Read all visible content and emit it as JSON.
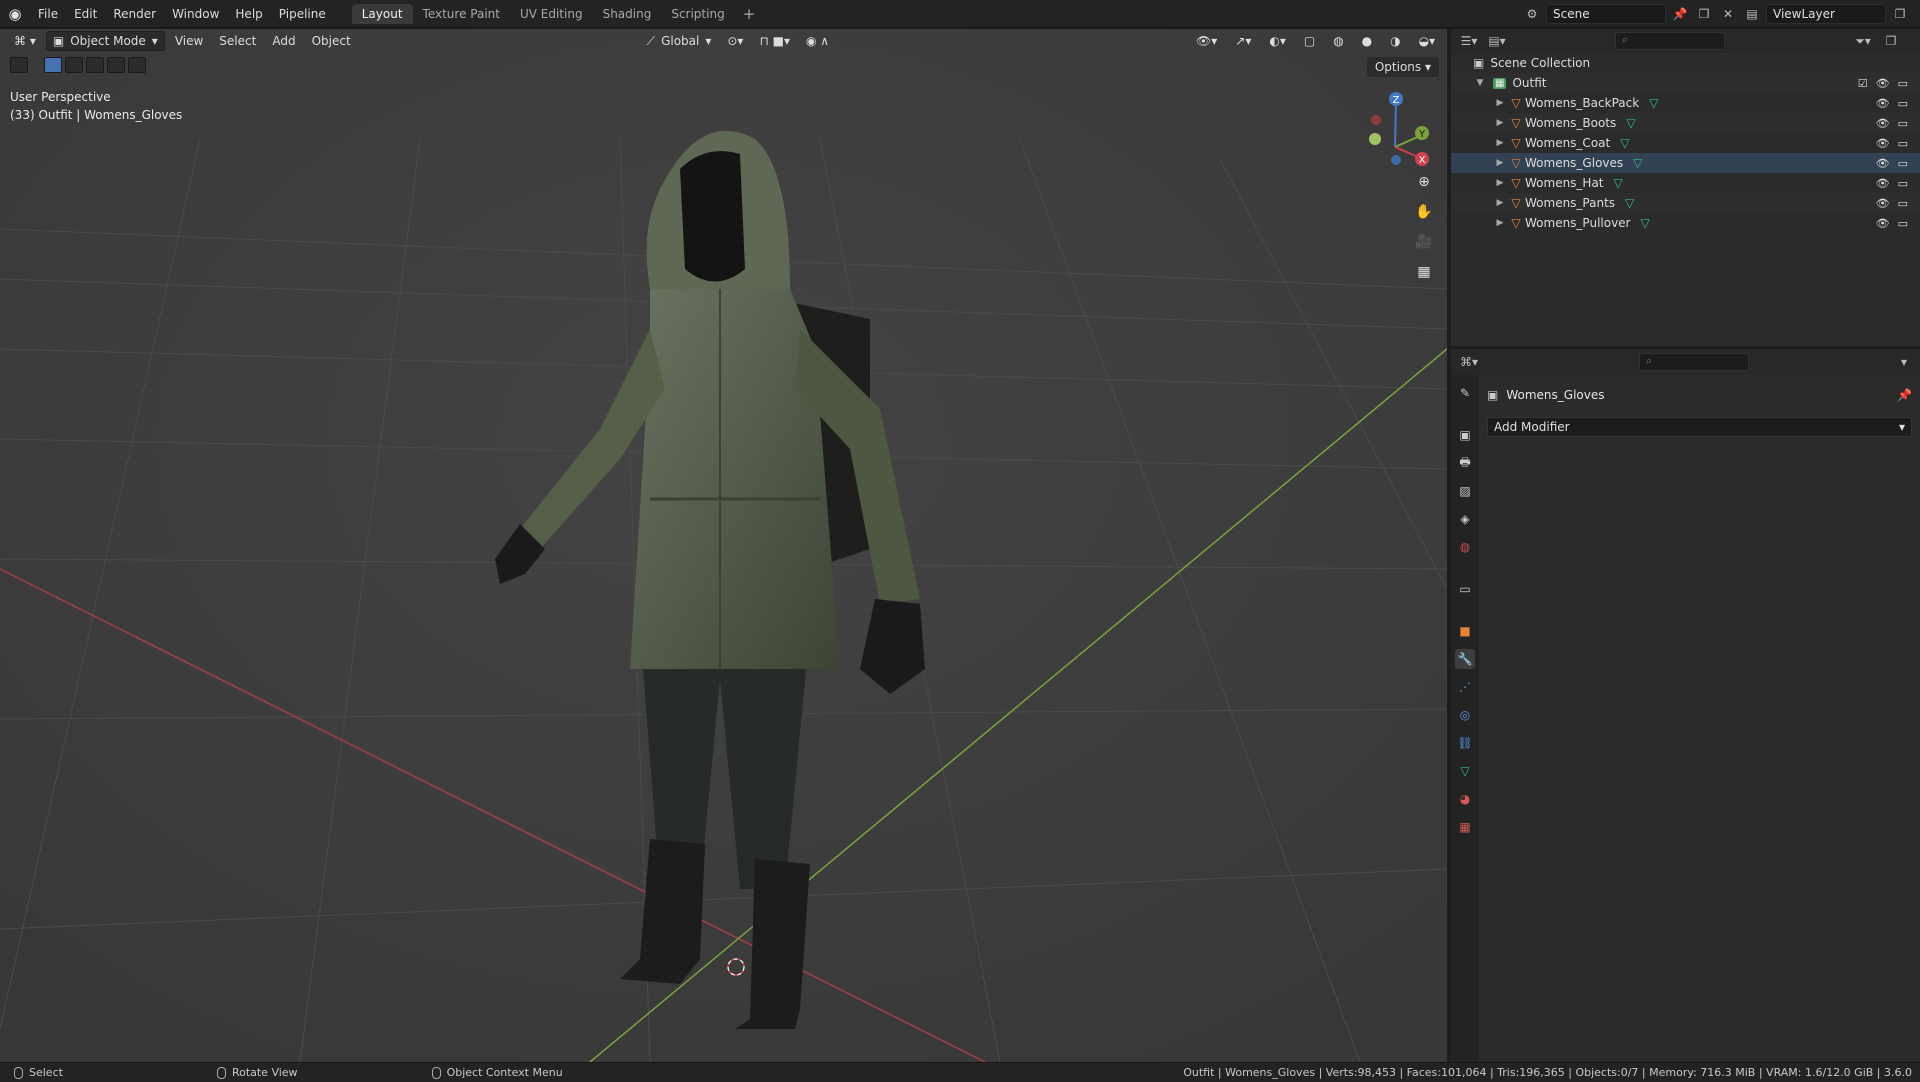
{
  "menubar": {
    "items": [
      "File",
      "Edit",
      "Render",
      "Window",
      "Help",
      "Pipeline"
    ],
    "workspaces": [
      "Layout",
      "Texture Paint",
      "UV Editing",
      "Shading",
      "Scripting"
    ],
    "active_workspace": "Layout",
    "add_workspace": "+"
  },
  "scene": {
    "name": "Scene",
    "view_layer": "ViewLayer"
  },
  "viewport": {
    "mode": "Object Mode",
    "menus": [
      "View",
      "Select",
      "Add",
      "Object"
    ],
    "transform_orientation": "Global",
    "options_label": "Options",
    "perspective_label": "User Perspective",
    "context_label": "(33) Outfit | Womens_Gloves",
    "gizmo_axes": {
      "x": "X",
      "y": "Y",
      "z": "Z"
    },
    "colors": {
      "x_axis": "#b8404a",
      "y_axis": "#7ba33d",
      "grid": "#4a4a4a",
      "background": "#3d3d3d"
    }
  },
  "outliner": {
    "search_placeholder": "",
    "root": "Scene Collection",
    "collection": "Outfit",
    "objects": [
      {
        "name": "Womens_BackPack",
        "selected": false
      },
      {
        "name": "Womens_Boots",
        "selected": false
      },
      {
        "name": "Womens_Coat",
        "selected": false
      },
      {
        "name": "Womens_Gloves",
        "selected": true
      },
      {
        "name": "Womens_Hat",
        "selected": false
      },
      {
        "name": "Womens_Pants",
        "selected": false
      },
      {
        "name": "Womens_Pullover",
        "selected": false
      }
    ]
  },
  "properties": {
    "object_name": "Womens_Gloves",
    "add_modifier_label": "Add Modifier",
    "tabs": [
      "tool",
      "render",
      "output",
      "view-layer",
      "scene",
      "world",
      "collection",
      "object",
      "modifiers",
      "particles",
      "physics",
      "constraints",
      "data",
      "material",
      "texture"
    ],
    "active_tab": "modifiers"
  },
  "statusbar": {
    "select_label": "Select",
    "rotate_label": "Rotate View",
    "context_menu_label": "Object Context Menu",
    "stats": "Outfit | Womens_Gloves | Verts:98,453 | Faces:101,064 | Tris:196,365 | Objects:0/7 | Memory: 716.3 MiB | VRAM: 1.6/12.0 GiB | 3.6.0"
  }
}
